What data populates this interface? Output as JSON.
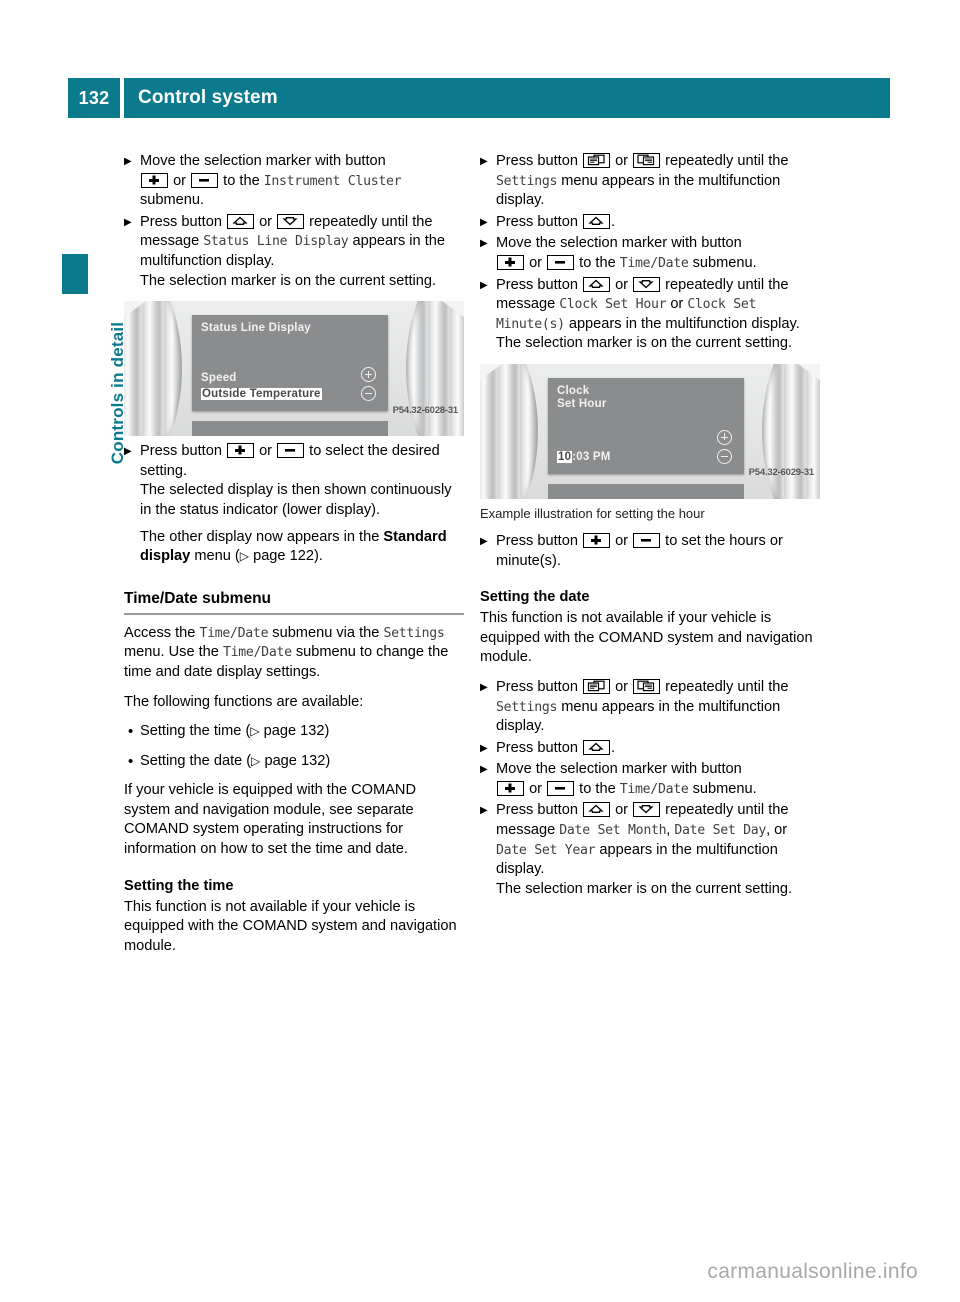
{
  "header": {
    "page_number": "132",
    "title": "Control system"
  },
  "sidebar": {
    "chapter_label": "Controls in detail"
  },
  "colors": {
    "accent_teal": "#0c7a8d",
    "rule_gray": "#9a9a9a",
    "mono_gray": "#3f3f3f"
  },
  "icons": {
    "plus": "plus-button-icon",
    "minus": "minus-button-icon",
    "up": "up-arrow-button-icon",
    "down": "down-arrow-button-icon",
    "page_back": "page-back-button-icon",
    "page_forward": "page-forward-button-icon",
    "page_ref_arrow": "▷"
  },
  "left_column": {
    "step1": {
      "t1": "Move the selection marker with button",
      "t2": "or",
      "t3": "to the",
      "mono1": "Instrument Cluster",
      "t4": "submenu."
    },
    "step2": {
      "t1": "Press button",
      "t2": "or",
      "t3": "repeatedly until the message",
      "mono1": "Status Line Display",
      "t4": "appears in the multifunction display.",
      "t5": "The selection marker is on the current setting."
    },
    "figure1": {
      "title": "Status Line Display",
      "row1": "Speed",
      "row2": "Outside Temperature",
      "code": "P54.32-6028-31"
    },
    "step3": {
      "t1": "Press button",
      "t2": "or",
      "t3": "to select the desired setting.",
      "t4": "The selected display is then shown continuously in the status indicator (lower display).",
      "t5": "The other display now appears in the",
      "bold1": "Standard display",
      "t6": "menu (",
      "t7": "page 122)."
    },
    "section_heading": "Time/Date submenu",
    "para1": {
      "t1": "Access the",
      "mono1": "Time/Date",
      "t2": "submenu via the",
      "mono2": "Settings",
      "t3": "menu. Use the",
      "mono3": "Time/Date",
      "t4": "submenu to change the time and date display settings."
    },
    "para2": "The following functions are available:",
    "bullet1": {
      "t1": "Setting the time (",
      "t2": "page 132)"
    },
    "bullet2": {
      "t1": "Setting the date (",
      "t2": "page 132)"
    },
    "para3": "If your vehicle is equipped with the COMAND system and navigation module, see separate COMAND system operating instructions for information on how to set the time and date.",
    "subsection_heading": "Setting the time",
    "para4": "This function is not available if your vehicle is equipped with the COMAND system and navigation module."
  },
  "right_column": {
    "step1": {
      "t1": "Press button",
      "t2": "or",
      "t3": "repeatedly until the",
      "mono1": "Settings",
      "t4": "menu appears in the multifunction display."
    },
    "step2": {
      "t1": "Press button",
      "t2": "."
    },
    "step3": {
      "t1": "Move the selection marker with button",
      "t2": "or",
      "t3": "to the",
      "mono1": "Time/Date",
      "t4": "submenu."
    },
    "step4": {
      "t1": "Press button",
      "t2": "or",
      "t3": "repeatedly until the message",
      "mono1": "Clock Set Hour",
      "t4": "or",
      "mono2": "Clock Set Minute(s)",
      "t5": "appears in the multifunction display.",
      "t6": "The selection marker is on the current setting."
    },
    "figure2": {
      "title_line1": "Clock",
      "title_line2": "Set Hour",
      "time_highlight": "10",
      "time_rest": ":03 PM",
      "code": "P54.32-6029-31"
    },
    "figure2_caption": "Example illustration for setting the hour",
    "step5": {
      "t1": "Press button",
      "t2": "or",
      "t3": "to set the hours or minute(s)."
    },
    "subsection_heading": "Setting the date",
    "para1": "This function is not available if your vehicle is equipped with the COMAND system and navigation module.",
    "step6": {
      "t1": "Press button",
      "t2": "or",
      "t3": "repeatedly until the",
      "mono1": "Settings",
      "t4": "menu appears in the multifunction display."
    },
    "step7": {
      "t1": "Press button",
      "t2": "."
    },
    "step8": {
      "t1": "Move the selection marker with button",
      "t2": "or",
      "t3": "to the",
      "mono1": "Time/Date",
      "t4": "submenu."
    },
    "step9": {
      "t1": "Press button",
      "t2": "or",
      "t3": "repeatedly until the message",
      "mono1": "Date Set Month",
      "sep1": ",",
      "mono2": "Date Set Day",
      "t4": ", or",
      "mono3": "Date Set Year",
      "t5": "appears in the multifunction display.",
      "t6": "The selection marker is on the current setting."
    }
  },
  "footer": {
    "watermark": "carmanualsonline.info"
  }
}
